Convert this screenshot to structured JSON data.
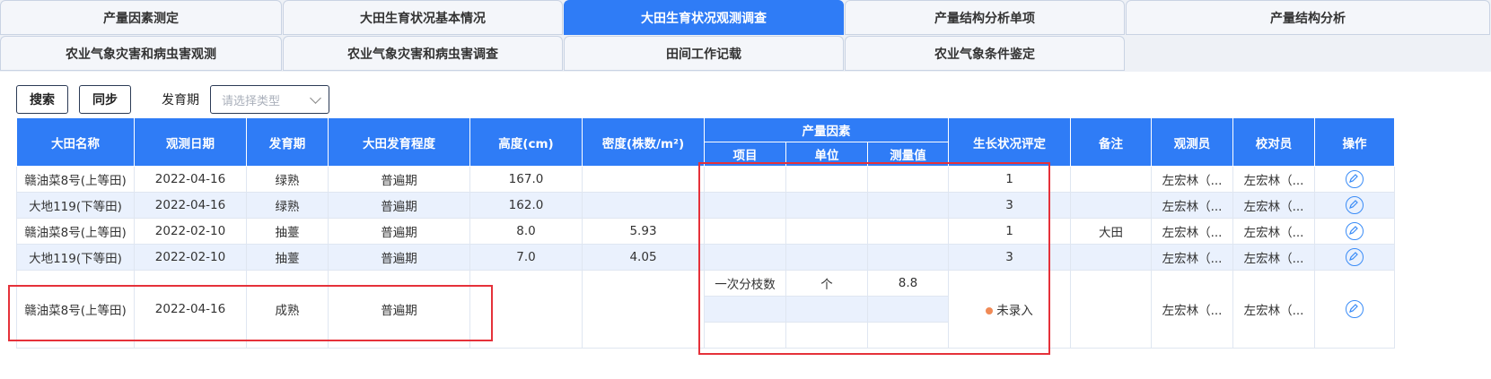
{
  "tabs": {
    "row1": [
      {
        "label": "产量因素测定",
        "active": false
      },
      {
        "label": "大田生育状况基本情况",
        "active": false
      },
      {
        "label": "大田生育状况观测调查",
        "active": true
      },
      {
        "label": "产量结构分析单项",
        "active": false
      },
      {
        "label": "产量结构分析",
        "active": false
      }
    ],
    "row2": [
      {
        "label": "农业气象灾害和病虫害观测"
      },
      {
        "label": "农业气象灾害和病虫害调查"
      },
      {
        "label": "田间工作记载"
      },
      {
        "label": "农业气象条件鉴定"
      }
    ]
  },
  "toolbar": {
    "search_label": "搜索",
    "sync_label": "同步",
    "stage_label": "发育期",
    "stage_placeholder": "请选择类型"
  },
  "table": {
    "headers": {
      "name": "大田名称",
      "date": "观测日期",
      "stage": "发育期",
      "degree": "大田发育程度",
      "height": "高度(cm)",
      "density": "密度(株数/m²)",
      "yield_group": "产量因素",
      "item": "项目",
      "unit": "单位",
      "value": "测量值",
      "growth": "生长状况评定",
      "note": "备注",
      "observer": "观测员",
      "checker": "校对员",
      "action": "操作"
    },
    "rows": [
      {
        "name": "赣油菜8号(上等田)",
        "date": "2022-04-16",
        "stage": "绿熟",
        "degree": "普遍期",
        "height": "167.0",
        "density": "",
        "item": "",
        "unit": "",
        "value": "",
        "growth": "1",
        "note": "",
        "observer": "左宏林（...",
        "checker": "左宏林（..."
      },
      {
        "name": "大地119(下等田)",
        "date": "2022-04-16",
        "stage": "绿熟",
        "degree": "普遍期",
        "height": "162.0",
        "density": "",
        "item": "",
        "unit": "",
        "value": "",
        "growth": "3",
        "note": "",
        "observer": "左宏林（...",
        "checker": "左宏林（..."
      },
      {
        "name": "赣油菜8号(上等田)",
        "date": "2022-02-10",
        "stage": "抽薹",
        "degree": "普遍期",
        "height": "8.0",
        "density": "5.93",
        "item": "",
        "unit": "",
        "value": "",
        "growth": "1",
        "note": "大田",
        "observer": "左宏林（...",
        "checker": "左宏林（..."
      },
      {
        "name": "大地119(下等田)",
        "date": "2022-02-10",
        "stage": "抽薹",
        "degree": "普遍期",
        "height": "7.0",
        "density": "4.05",
        "item": "",
        "unit": "",
        "value": "",
        "growth": "3",
        "note": "",
        "observer": "左宏林（...",
        "checker": "左宏林（..."
      }
    ],
    "last_row": {
      "name": "赣油菜8号(上等田)",
      "date": "2022-04-16",
      "stage": "成熟",
      "degree": "普遍期",
      "height": "",
      "density": "",
      "sub_rows": [
        {
          "item": "一次分枝数",
          "unit": "个",
          "value": "8.8"
        },
        {
          "item": "",
          "unit": "",
          "value": ""
        },
        {
          "item": "",
          "unit": "",
          "value": ""
        }
      ],
      "growth": "未录入",
      "note": "",
      "observer": "左宏林（...",
      "checker": "左宏林（..."
    }
  },
  "colors": {
    "accent": "#2f7cf6",
    "row_alt": "#eaf1fd",
    "highlight": "#e5313a",
    "status_dot": "#f08a56"
  },
  "icons": {
    "edit": "edit-icon",
    "dropdown": "chevron-down-icon"
  }
}
